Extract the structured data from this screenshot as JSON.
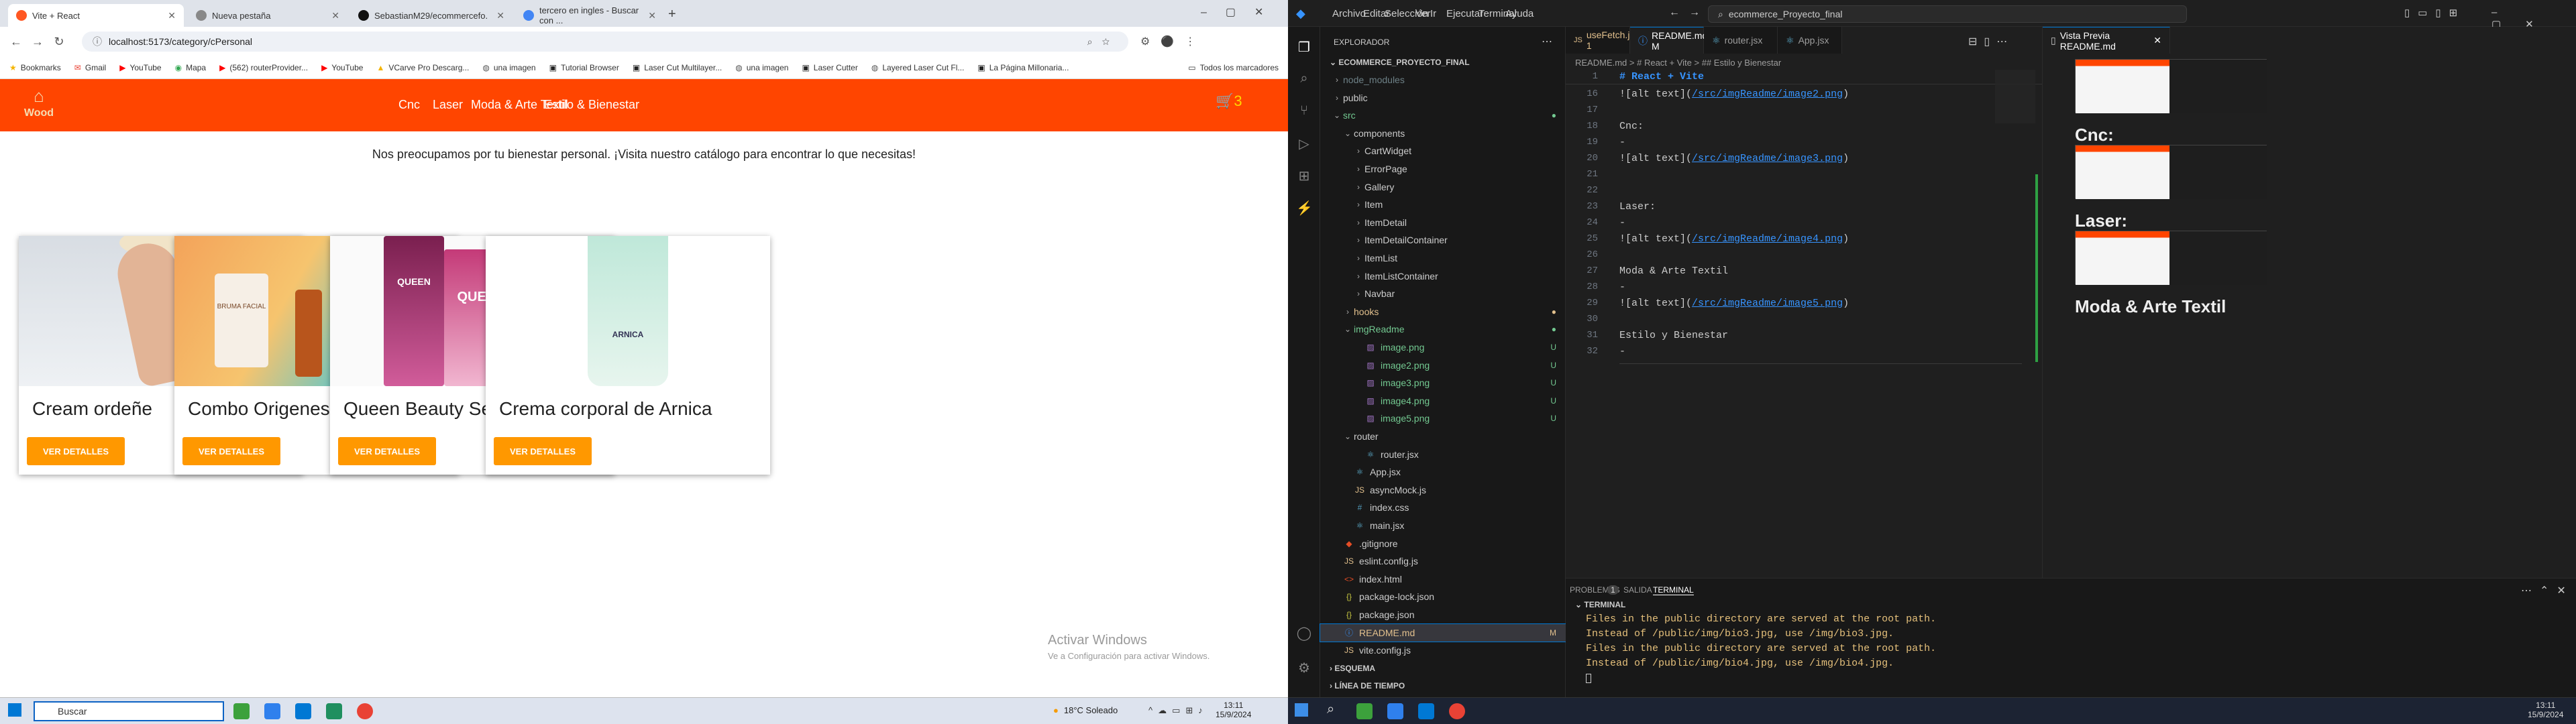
{
  "browser": {
    "tabs": [
      {
        "label": "Vite + React",
        "color": "#ff5722",
        "active": true
      },
      {
        "label": "Nueva pestaña",
        "color": "#888888",
        "active": false
      },
      {
        "label": "SebastianM29/ecommercefo...",
        "color": "#111111",
        "active": false
      },
      {
        "label": "tercero en ingles - Buscar con ...",
        "color": "#4285f4",
        "active": false
      }
    ],
    "url": "localhost:5173/category/cPersonal",
    "bookmarks": [
      "Bookmarks",
      "Gmail",
      "YouTube",
      "Mapa",
      "(562) routerProvider...",
      "YouTube",
      "VCarve Pro Descarg...",
      "una imagen",
      "Tutorial Browser",
      "Laser Cut Multilayer...",
      "una imagen",
      "Laser Cutter",
      "Layered Laser Cut Fl...",
      "La Página Millonaria..."
    ],
    "all_bookmarks": "Todos los marcadores"
  },
  "site": {
    "logo_text": "Wood",
    "nav": [
      "Cnc",
      "Laser",
      "Moda & Arte Textil",
      "Estilo & Bienestar"
    ],
    "cart_count": "3",
    "tagline": "Nos preocupamos por tu bienestar personal. ¡Visita nuestro catálogo para encontrar lo que necesitas!",
    "products": [
      {
        "title": "Cream ordeñe",
        "button": "VER DETALLES"
      },
      {
        "title": "Combo Origenes",
        "button": "VER DETALLES"
      },
      {
        "title": "Queen Beauty Set",
        "button": "VER DETALLES"
      },
      {
        "title": "Crema corporal de Arnica",
        "button": "VER DETALLES"
      }
    ],
    "product_image_text": {
      "bruma": "BRUMA FACIAL",
      "queen": "QUEEN",
      "arnica": "ARNICA"
    }
  },
  "watermark": {
    "title": "Activar Windows",
    "subtitle": "Ve a Configuración para activar Windows."
  },
  "left_taskbar": {
    "search": "Buscar",
    "weather": "18°C  Soleado",
    "time": "13:11",
    "date": "15/9/2024"
  },
  "vscode": {
    "menus": [
      "Archivo",
      "Editar",
      "Selección",
      "Ver",
      "Ir",
      "Ejecutar",
      "Terminal",
      "Ayuda"
    ],
    "command_center": "ecommerce_Proyecto_final",
    "explorer_title": "EXPLORADOR",
    "project": "ECOMMERCE_PROYECTO_FINAL",
    "tree": [
      {
        "name": "node_modules",
        "indent": 1,
        "type": "folder",
        "open": false,
        "color": "#6d8086"
      },
      {
        "name": "public",
        "indent": 1,
        "type": "folder",
        "open": false,
        "color": "#cccccc"
      },
      {
        "name": "src",
        "indent": 1,
        "type": "folder",
        "open": true,
        "color": "#73c991",
        "dot": true
      },
      {
        "name": "components",
        "indent": 2,
        "type": "folder",
        "open": true,
        "color": "#cccccc"
      },
      {
        "name": "CartWidget",
        "indent": 3,
        "type": "folder",
        "open": false,
        "color": "#cccccc"
      },
      {
        "name": "ErrorPage",
        "indent": 3,
        "type": "folder",
        "open": false,
        "color": "#cccccc"
      },
      {
        "name": "Gallery",
        "indent": 3,
        "type": "folder",
        "open": false,
        "color": "#cccccc"
      },
      {
        "name": "Item",
        "indent": 3,
        "type": "folder",
        "open": false,
        "color": "#cccccc"
      },
      {
        "name": "ItemDetail",
        "indent": 3,
        "type": "folder",
        "open": false,
        "color": "#cccccc"
      },
      {
        "name": "ItemDetailContainer",
        "indent": 3,
        "type": "folder",
        "open": false,
        "color": "#cccccc"
      },
      {
        "name": "ItemList",
        "indent": 3,
        "type": "folder",
        "open": false,
        "color": "#cccccc"
      },
      {
        "name": "ItemListContainer",
        "indent": 3,
        "type": "folder",
        "open": false,
        "color": "#cccccc"
      },
      {
        "name": "Navbar",
        "indent": 3,
        "type": "folder",
        "open": false,
        "color": "#cccccc"
      },
      {
        "name": "hooks",
        "indent": 2,
        "type": "folder",
        "open": false,
        "color": "#e2c08d",
        "dot": true
      },
      {
        "name": "imgReadme",
        "indent": 2,
        "type": "folder",
        "open": true,
        "color": "#73c991",
        "dot": true
      },
      {
        "name": "image.png",
        "indent": 3,
        "type": "img",
        "color": "#73c991",
        "badge": "U"
      },
      {
        "name": "image2.png",
        "indent": 3,
        "type": "img",
        "color": "#73c991",
        "badge": "U"
      },
      {
        "name": "image3.png",
        "indent": 3,
        "type": "img",
        "color": "#73c991",
        "badge": "U"
      },
      {
        "name": "image4.png",
        "indent": 3,
        "type": "img",
        "color": "#73c991",
        "badge": "U"
      },
      {
        "name": "image5.png",
        "indent": 3,
        "type": "img",
        "color": "#73c991",
        "badge": "U"
      },
      {
        "name": "router",
        "indent": 2,
        "type": "folder",
        "open": true,
        "color": "#cccccc"
      },
      {
        "name": "router.jsx",
        "indent": 3,
        "type": "jsx",
        "color": "#cccccc"
      },
      {
        "name": "App.jsx",
        "indent": 2,
        "type": "jsx",
        "color": "#cccccc"
      },
      {
        "name": "asyncMock.js",
        "indent": 2,
        "type": "js",
        "color": "#cccccc"
      },
      {
        "name": "index.css",
        "indent": 2,
        "type": "css",
        "color": "#cccccc"
      },
      {
        "name": "main.jsx",
        "indent": 2,
        "type": "jsx",
        "color": "#cccccc"
      },
      {
        "name": ".gitignore",
        "indent": 1,
        "type": "git",
        "color": "#cccccc"
      },
      {
        "name": "eslint.config.js",
        "indent": 1,
        "type": "js",
        "color": "#cccccc"
      },
      {
        "name": "index.html",
        "indent": 1,
        "type": "html",
        "color": "#cccccc"
      },
      {
        "name": "package-lock.json",
        "indent": 1,
        "type": "json",
        "color": "#cccccc"
      },
      {
        "name": "package.json",
        "indent": 1,
        "type": "json",
        "color": "#cccccc"
      },
      {
        "name": "README.md",
        "indent": 1,
        "type": "md",
        "color": "#e2c08d",
        "badge": "M",
        "selected": true
      },
      {
        "name": "vite.config.js",
        "indent": 1,
        "type": "js",
        "color": "#cccccc"
      }
    ],
    "outline": [
      "ESQUEMA",
      "LÍNEA DE TIEMPO"
    ],
    "editor_tabs": [
      {
        "label": "useFetch.js 1",
        "color": "#e2c08d"
      },
      {
        "label": "README.md M",
        "color": "#ffffff",
        "active": true
      },
      {
        "label": "router.jsx",
        "color": "#9d9d9d"
      },
      {
        "label": "App.jsx",
        "color": "#9d9d9d"
      }
    ],
    "breadcrumb": "README.md > # React + Vite > ## Estilo y Bienestar",
    "sticky_heading": "# React + Vite",
    "code_lines": [
      {
        "n": "16",
        "pre": "![alt text](",
        "link": "/src/imgReadme/image2.png",
        "post": ")"
      },
      {
        "n": "17",
        "pre": "",
        "link": "",
        "post": ""
      },
      {
        "n": "18",
        "pre": "Cnc:",
        "link": "",
        "post": ""
      },
      {
        "n": "19",
        "pre": "-",
        "link": "",
        "post": ""
      },
      {
        "n": "20",
        "pre": "![alt text](",
        "link": "/src/imgReadme/image3.png",
        "post": ")"
      },
      {
        "n": "21",
        "pre": "",
        "link": "",
        "post": ""
      },
      {
        "n": "22",
        "pre": "",
        "link": "",
        "post": ""
      },
      {
        "n": "23",
        "pre": "Laser:",
        "link": "",
        "post": ""
      },
      {
        "n": "24",
        "pre": "-",
        "link": "",
        "post": ""
      },
      {
        "n": "25",
        "pre": "![alt text](",
        "link": "/src/imgReadme/image4.png",
        "post": ")"
      },
      {
        "n": "26",
        "pre": "",
        "link": "",
        "post": ""
      },
      {
        "n": "27",
        "pre": "Moda & Arte Textil",
        "link": "",
        "post": ""
      },
      {
        "n": "28",
        "pre": "-",
        "link": "",
        "post": ""
      },
      {
        "n": "29",
        "pre": "![alt text](",
        "link": "/src/imgReadme/image5.png",
        "post": ")"
      },
      {
        "n": "30",
        "pre": "",
        "link": "",
        "post": ""
      },
      {
        "n": "31",
        "pre": "Estilo y Bienestar",
        "link": "",
        "post": ""
      },
      {
        "n": "32",
        "pre": "-",
        "link": "",
        "post": ""
      }
    ],
    "preview_tab": "Vista Previa README.md",
    "preview_headings": [
      "Cnc:",
      "Laser:",
      "Moda & Arte Textil"
    ],
    "panel_tabs": [
      "PROBLEMAS",
      "1",
      "SALIDA",
      "TERMINAL"
    ],
    "terminal_section": "TERMINAL",
    "terminal_lines": [
      "Files in the public directory are served at the root path.",
      "Instead of /public/img/bio3.jpg, use /img/bio3.jpg.",
      "Files in the public directory are served at the root path.",
      "Instead of /public/img/bio4.jpg, use /img/bio4.jpg."
    ],
    "time": "13:11",
    "date": "15/9/2024"
  },
  "colors": {
    "site_orange": "#ff4500",
    "button_orange": "#ff9800",
    "vscode_accent": "#0078d4"
  }
}
